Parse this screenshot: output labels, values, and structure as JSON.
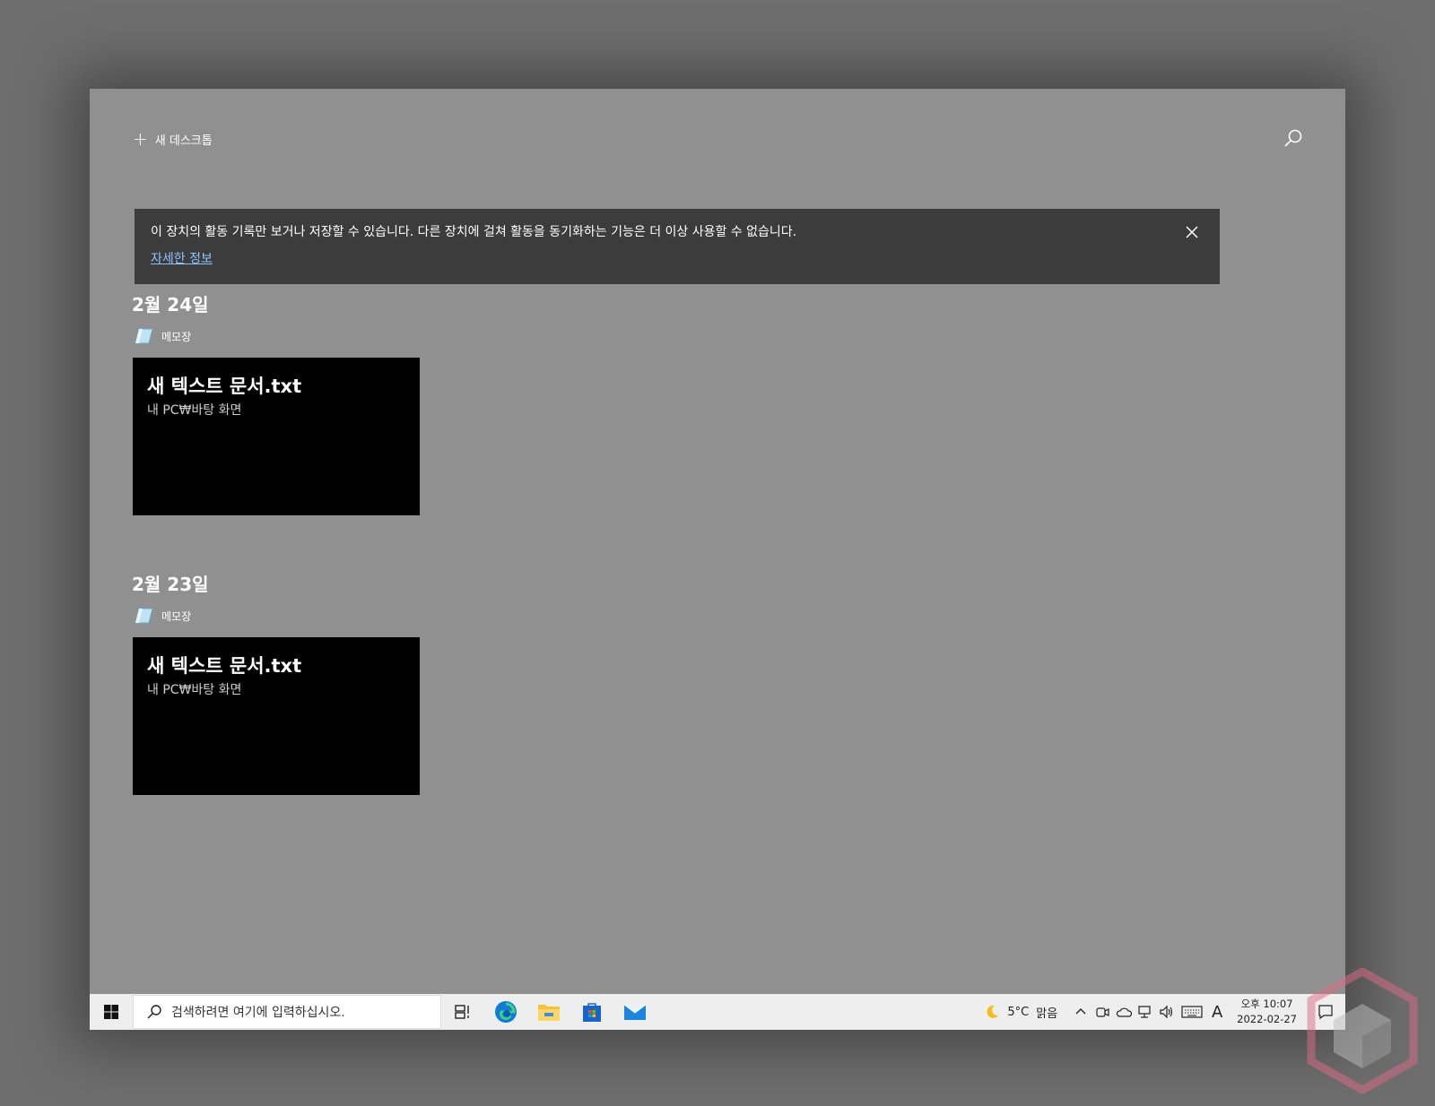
{
  "timeline": {
    "new_desktop_label": "새 데스크톱",
    "banner": {
      "message": "이 장치의 활동 기록만 보거나 저장할 수 있습니다. 다른 장치에 걸쳐 활동을 동기화하는 기능은 더 이상 사용할 수 없습니다.",
      "link": "자세한 정보"
    },
    "groups": [
      {
        "date": "2월 24일",
        "app": "메모장",
        "card_title": "새 텍스트 문서.txt",
        "card_subtitle": "내 PC₩바탕 화면"
      },
      {
        "date": "2월 23일",
        "app": "메모장",
        "card_title": "새 텍스트 문서.txt",
        "card_subtitle": "내 PC₩바탕 화면"
      }
    ]
  },
  "taskbar": {
    "search_placeholder": "검색하려면 여기에 입력하십시오.",
    "weather": {
      "temp": "5°C",
      "condition": "맑음"
    },
    "input_indicator": "A",
    "clock": {
      "time": "오후 10:07",
      "date": "2022-02-27"
    }
  },
  "colors": {
    "overlay": "#909090",
    "banner_bg": "#3c3c3c",
    "link": "#8ec4ff",
    "card_bg": "#000000",
    "taskbar_bg": "#eeeeee",
    "edge_blue": "#0f7bd6",
    "explorer_yellow": "#f5c33b",
    "store_blue": "#1964c8",
    "mail_blue": "#1a86e0"
  },
  "icons": [
    "plus-icon",
    "search-icon",
    "close-icon",
    "notepad-icon",
    "windows-start-icon",
    "task-view-icon",
    "edge-icon",
    "file-explorer-icon",
    "store-icon",
    "mail-icon",
    "moon-icon",
    "chevron-up-icon",
    "meet-now-icon",
    "onedrive-icon",
    "network-icon",
    "volume-icon",
    "touch-keyboard-icon",
    "notification-icon"
  ]
}
